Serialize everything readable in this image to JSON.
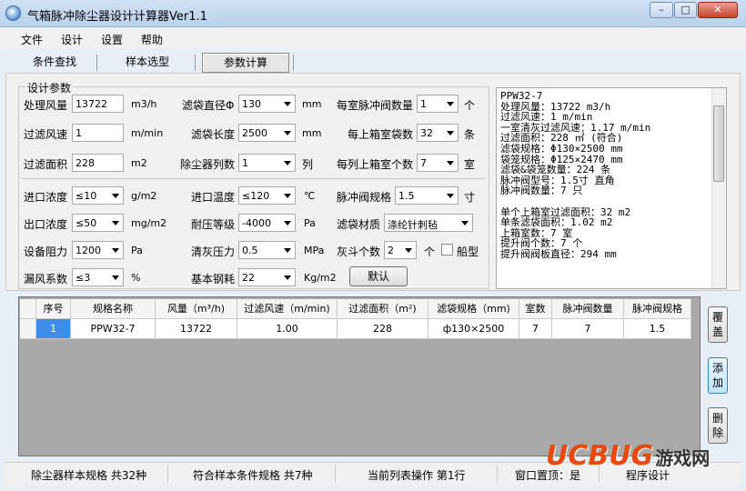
{
  "window": {
    "title": "气箱脉冲除尘器设计计算器Ver1.1",
    "min": "–",
    "max": "□",
    "close": "✕"
  },
  "menu": [
    "文件",
    "设计",
    "设置",
    "帮助"
  ],
  "tabs": [
    "条件查找",
    "样本选型",
    "参数计算"
  ],
  "group_label": "设计参数",
  "fields": {
    "air_volume": {
      "label": "处理风量",
      "value": "13722",
      "unit": "m3/h"
    },
    "filter_speed": {
      "label": "过滤风速",
      "value": "1",
      "unit": "m/min"
    },
    "filter_area": {
      "label": "过滤面积",
      "value": "228",
      "unit": "m2"
    },
    "bag_diameter": {
      "label": "滤袋直径Φ",
      "value": "130",
      "unit": "mm"
    },
    "bag_length": {
      "label": "滤袋长度",
      "value": "2500",
      "unit": "mm"
    },
    "columns": {
      "label": "除尘器列数",
      "value": "1",
      "unit": "列"
    },
    "valves_per_room": {
      "label": "每室脉冲阀数量",
      "value": "1",
      "unit": "个"
    },
    "bags_per_room": {
      "label": "每上箱室袋数",
      "value": "32",
      "unit": "条"
    },
    "rooms_per_column": {
      "label": "每列上箱室个数",
      "value": "7",
      "unit": "室"
    },
    "inlet_conc": {
      "label": "进口浓度",
      "value": "≤10",
      "unit": "g/m2"
    },
    "outlet_conc": {
      "label": "出口浓度",
      "value": "≤50",
      "unit": "mg/m2"
    },
    "resistance": {
      "label": "设备阻力",
      "value": "1200",
      "unit": "Pa"
    },
    "leak": {
      "label": "漏风系数",
      "value": "≤3",
      "unit": "%"
    },
    "inlet_temp": {
      "label": "进口温度",
      "value": "≤120",
      "unit": "℃"
    },
    "pressure_grade": {
      "label": "耐压等级",
      "value": "-4000",
      "unit": "Pa"
    },
    "clean_pressure": {
      "label": "清灰压力",
      "value": "0.5",
      "unit": "MPa"
    },
    "steel": {
      "label": "基本钢耗",
      "value": "22",
      "unit": "Kg/m2"
    },
    "valve_spec": {
      "label": "脉冲阀规格",
      "value": "1.5",
      "unit": "寸"
    },
    "bag_material": {
      "label": "滤袋材质",
      "value": "涤纶针刺毡"
    },
    "hopper": {
      "label": "灰斗个数",
      "value": "2",
      "unit": "个"
    },
    "ship_type": {
      "label": "船型"
    }
  },
  "default_button": "默认",
  "result_lines": [
    "PPW32-7",
    "处理风量：13722 m3/h",
    "过滤风速：1 m/min",
    "一室清灰过滤风速：1.17 m/min",
    "过滤面积：228 ㎡ (符合)",
    "滤袋规格：Φ130×2500 mm",
    "袋笼规格：Φ125×2470 mm",
    "滤袋&袋笼数量：224 条",
    "脉冲阀型号：1.5寸 直角",
    "脉冲阀数量：7 只",
    "",
    "单个上箱室过滤面积：32 m2",
    "单条滤袋面积：1.02 m2",
    "上箱室数：7 室",
    "提升阀个数：7 个",
    "提升阀阀板直径：294 mm"
  ],
  "table": {
    "headers": [
      "序号",
      "规格名称",
      "风量（m³/h)",
      "过滤风速（m/min)",
      "过滤面积（m²)",
      "滤袋规格（mm)",
      "室数",
      "脉冲阀数量",
      "脉冲阀规格"
    ],
    "rows": [
      [
        "1",
        "PPW32-7",
        "13722",
        "1.00",
        "228",
        "ф130×2500",
        "7",
        "7",
        "1.5"
      ]
    ]
  },
  "side_buttons": [
    "覆盖",
    "添加",
    "删除"
  ],
  "status": [
    "除尘器样本规格 共32种",
    "符合样本条件规格 共7种",
    "当前列表操作 第1行",
    "窗口置顶：是",
    "程序设计"
  ],
  "watermark": {
    "brand": "UCBUG",
    "suffix": "游戏网"
  }
}
